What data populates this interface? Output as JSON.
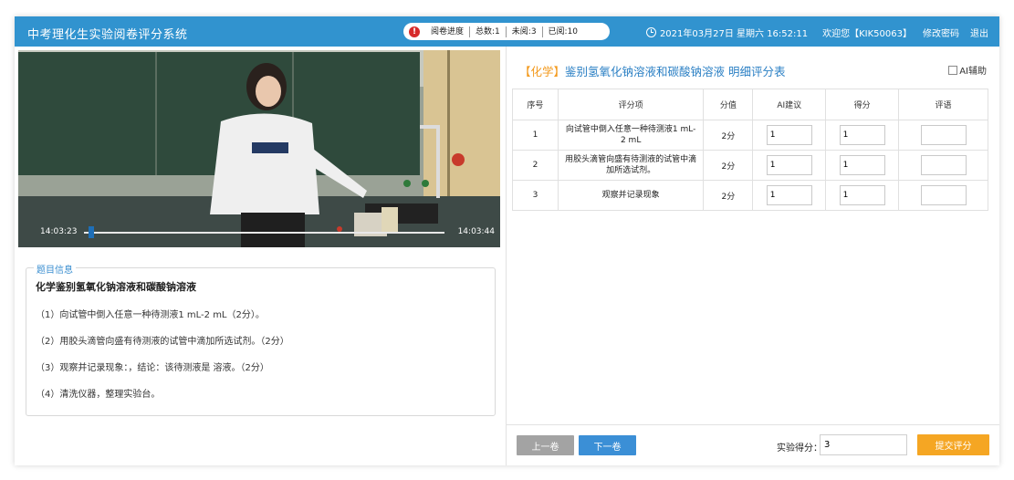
{
  "header": {
    "title": "中考理化生实验阅卷评分系统",
    "progress_label": "阅卷进度",
    "total": "总数:1",
    "unread": "未阅:3",
    "read": "已阅:10",
    "datetime": "2021年03月27日 星期六 16:52:11",
    "welcome": "欢迎您【KIK50063】",
    "change_password": "修改密码",
    "logout": "退出"
  },
  "video": {
    "current_time": "14:03:23",
    "end_time": "14:03:44",
    "progress": 0.02
  },
  "question": {
    "legend": "题目信息",
    "title": "化学鉴别氢氧化钠溶液和碳酸钠溶液",
    "items": [
      "（1）向试管中倒入任意一种待测液1 mL-2 mL（2分）。",
      "（2）用胶头滴管向盛有待测液的试管中滴加所选试剂。（2分）",
      "（3）观察并记录现象：，结论：该待测液是 溶液。（2分）",
      "（4）清洗仪器，整理实验台。"
    ]
  },
  "score_sheet": {
    "subject": "【化学】",
    "title": "鉴别氢氧化钠溶液和碳酸钠溶液 明细评分表",
    "ai_assist": "AI辅助",
    "columns": [
      "序号",
      "评分项",
      "分值",
      "AI建议",
      "得分",
      "评语"
    ],
    "rows": [
      {
        "no": "1",
        "item": "向试管中倒入任意一种待测液1 mL-2 mL",
        "points": "2分",
        "ai": "1",
        "score": "1",
        "comment": ""
      },
      {
        "no": "2",
        "item": "用胶头滴管向盛有待测液的试管中滴加所选试剂。",
        "points": "2分",
        "ai": "1",
        "score": "1",
        "comment": ""
      },
      {
        "no": "3",
        "item": "观察并记录现象",
        "points": "2分",
        "ai": "1",
        "score": "1",
        "comment": ""
      }
    ],
    "prev_label": "上一卷",
    "next_label": "下一卷",
    "total_label": "实验得分：",
    "total_value": "3",
    "submit_label": "提交评分"
  },
  "colors": {
    "header_bg": "#3193cf",
    "accent_blue": "#3b8fd6",
    "submit_orange": "#f5a623",
    "subject_orange": "#f39a1e",
    "warn_red": "#d62b2b"
  }
}
